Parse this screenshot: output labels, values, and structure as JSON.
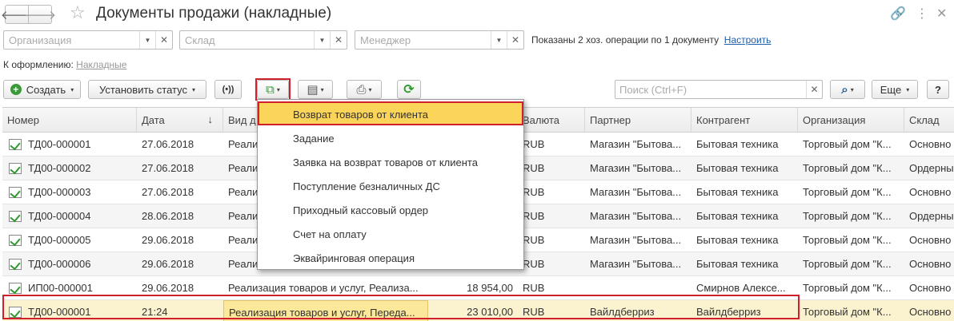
{
  "window": {
    "title": "Документы продажи (накладные)",
    "back_glyph": "🡐",
    "forward_glyph": "🡒",
    "star_glyph": "☆",
    "link_glyph": "🔗",
    "more_glyph": "⋮",
    "close_glyph": "✕"
  },
  "filters": {
    "organization_placeholder": "Организация",
    "warehouse_placeholder": "Склад",
    "manager_placeholder": "Менеджер",
    "dropdown_glyph": "▼",
    "clear_glyph": "✕",
    "info_text": "Показаны 2 хоз. операции по 1 документу",
    "configure_link": "Настроить"
  },
  "pending": {
    "label": "К оформлению:",
    "link": "Накладные"
  },
  "toolbar": {
    "create_label": "Создать",
    "set_status_label": "Установить статус",
    "radio_glyph": "(•))",
    "create_based_glyph": "⧉",
    "report_glyph": "▤",
    "print_glyph": "⎙",
    "refresh_glyph": "⟳",
    "search_placeholder": "Поиск (Ctrl+F)",
    "search_glyph": "⌕",
    "more_label": "Еще",
    "help_label": "?",
    "caret": "▾",
    "plus_glyph": "+"
  },
  "table": {
    "columns": [
      "Номер",
      "Дата",
      "Вид д",
      "",
      "Валюта",
      "Партнер",
      "Контрагент",
      "Организация",
      "Склад"
    ],
    "sort_glyph": "↓",
    "rows": [
      {
        "number": "ТД00-000001",
        "date": "27.06.2018",
        "type": "Реали",
        "sum": "",
        "currency": "RUB",
        "partner": "Магазин \"Бытова...",
        "counterparty": "Бытовая техника",
        "organization": "Торговый дом \"К...",
        "warehouse": "Основно"
      },
      {
        "number": "ТД00-000002",
        "date": "27.06.2018",
        "type": "Реали",
        "sum": "",
        "currency": "RUB",
        "partner": "Магазин \"Бытова...",
        "counterparty": "Бытовая техника",
        "organization": "Торговый дом \"К...",
        "warehouse": "Ордерны"
      },
      {
        "number": "ТД00-000003",
        "date": "27.06.2018",
        "type": "Реали",
        "sum": "",
        "currency": "RUB",
        "partner": "Магазин \"Бытова...",
        "counterparty": "Бытовая техника",
        "organization": "Торговый дом \"К...",
        "warehouse": "Основно"
      },
      {
        "number": "ТД00-000004",
        "date": "28.06.2018",
        "type": "Реали",
        "sum": "",
        "currency": "RUB",
        "partner": "Магазин \"Бытова...",
        "counterparty": "Бытовая техника",
        "organization": "Торговый дом \"К...",
        "warehouse": "Ордерны"
      },
      {
        "number": "ТД00-000005",
        "date": "29.06.2018",
        "type": "Реали",
        "sum": "",
        "currency": "RUB",
        "partner": "Магазин \"Бытова...",
        "counterparty": "Бытовая техника",
        "organization": "Торговый дом \"К...",
        "warehouse": "Основно"
      },
      {
        "number": "ТД00-000006",
        "date": "29.06.2018",
        "type": "Реали",
        "sum": "",
        "currency": "RUB",
        "partner": "Магазин \"Бытова...",
        "counterparty": "Бытовая техника",
        "organization": "Торговый дом \"К...",
        "warehouse": "Основно"
      },
      {
        "number": "ИП00-000001",
        "date": "29.06.2018",
        "type": "Реализация товаров и услуг, Реализа...",
        "sum": "18 954,00",
        "currency": "RUB",
        "partner": "",
        "counterparty": "Смирнов Алексе...",
        "organization": "Торговый дом \"К...",
        "warehouse": "Основно"
      },
      {
        "number": "ТД00-000001",
        "date": "21:24",
        "type": "Реализация товаров и услуг, Переда...",
        "sum": "23 010,00",
        "currency": "RUB",
        "partner": "Вайлдберриз",
        "counterparty": "Вайлдберриз",
        "organization": "Торговый дом \"К...",
        "warehouse": "Основно"
      }
    ]
  },
  "create_based_menu": {
    "items": [
      "Возврат товаров от клиента",
      "Задание",
      "Заявка на возврат товаров от клиента",
      "Поступление безналичных ДС",
      "Приходный кассовый ордер",
      "Счет на оплату",
      "Эквайринговая операция"
    ]
  },
  "colors": {
    "highlight_red": "#d0202b",
    "menu_active": "#fbd45a",
    "selected_row": "#fbf3cf",
    "link_blue": "#1f5ea8"
  }
}
